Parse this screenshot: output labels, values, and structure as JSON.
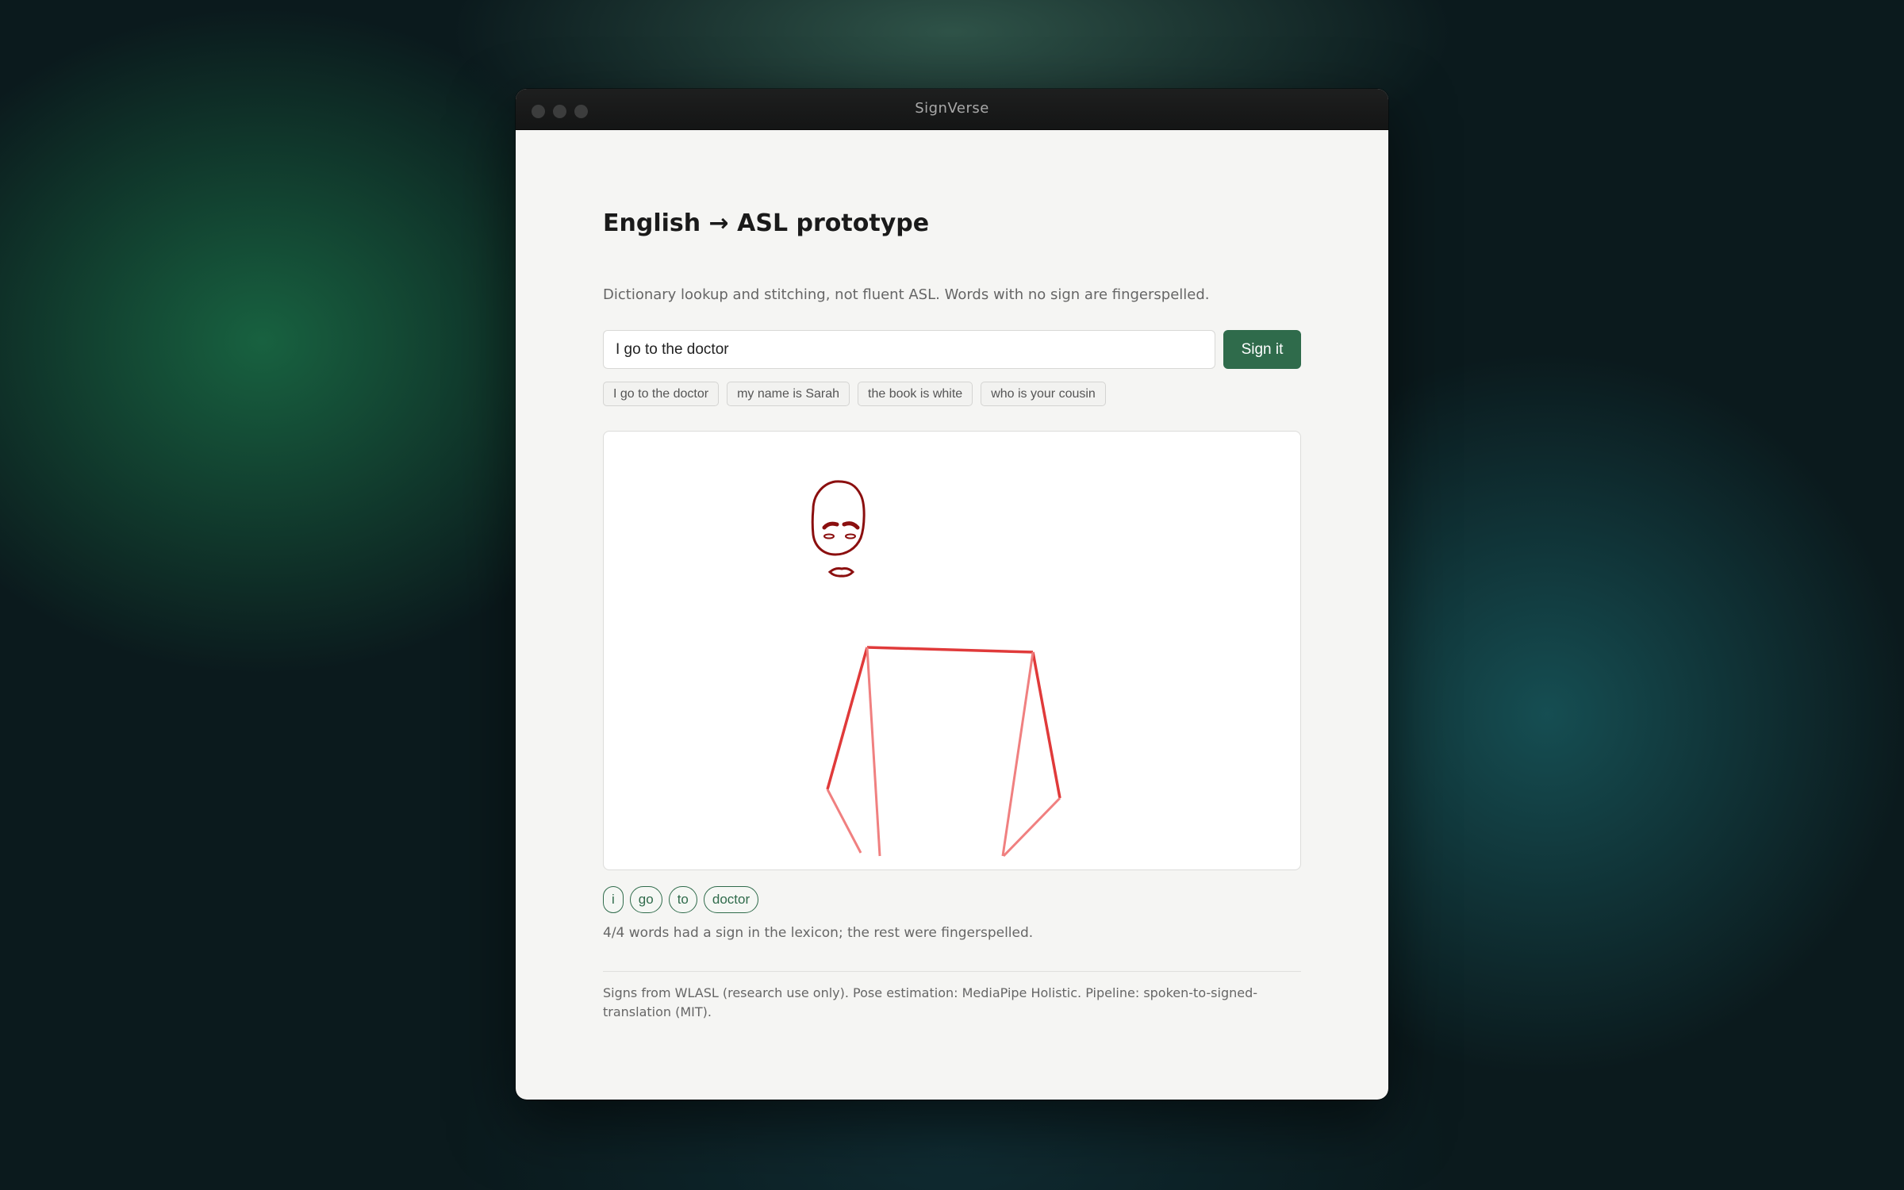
{
  "window": {
    "title": "SignVerse"
  },
  "header": {
    "title": "English → ASL prototype",
    "subtitle": "Dictionary lookup and stitching, not fluent ASL. Words with no sign are fingerspelled."
  },
  "input": {
    "value": "I go to the doctor",
    "button_label": "Sign it"
  },
  "examples": [
    "I go to the doctor",
    "my name is Sarah",
    "the book is white",
    "who is your cousin"
  ],
  "tokens": [
    "i",
    "go",
    "to",
    "doctor"
  ],
  "coverage_text": "4/4 words had a sign in the lexicon; the rest were fingerspelled.",
  "credits": "Signs from WLASL (research use only). Pose estimation: MediaPipe Holistic. Pipeline: spoken-to-signed-translation (MIT).",
  "colors": {
    "accent": "#2f6b4b",
    "pose_face": "#8b0f0f",
    "pose_body": "#e03a3a",
    "pose_arm_inner": "#f08080"
  }
}
